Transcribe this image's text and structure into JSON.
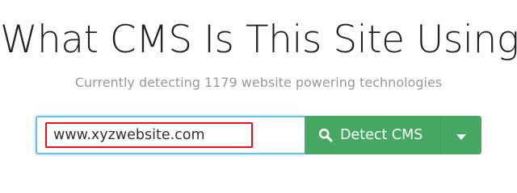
{
  "heading": {
    "title": "What CMS Is This Site Using?",
    "subtitle": "Currently detecting 1179 website powering technologies"
  },
  "search": {
    "url_value": "www.xyzwebsite.com",
    "button_label": "Detect CMS",
    "button_icon": "search-icon",
    "dropdown_icon": "caret-down-icon"
  },
  "colors": {
    "button_green": "#47a864",
    "input_focus_border": "#66c2e8",
    "highlight_red": "#e8101b",
    "subtitle_gray": "#999999"
  }
}
